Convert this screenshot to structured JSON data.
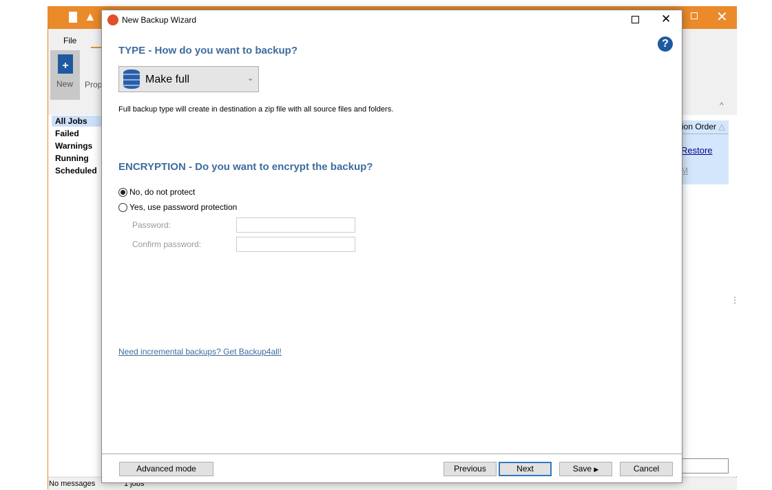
{
  "app": {
    "menu_file": "File",
    "ribbon_new": "New",
    "ribbon_properties": "Prop",
    "sidebar": [
      "All Jobs",
      "Failed",
      "Warnings",
      "Running",
      "Scheduled"
    ],
    "column_header": "ion Order",
    "link_restore": "Restore",
    "link_m": "M",
    "status_messages": "No messages",
    "status_jobs": "1 jobs"
  },
  "dialog": {
    "title": "New Backup Wizard",
    "type_heading": "TYPE - How do you want to backup?",
    "type_selected": "Make full",
    "type_description": "Full backup type will create in destination a zip file with all source files and folders.",
    "encryption_heading": "ENCRYPTION - Do you want to encrypt the backup?",
    "radio_no": "No, do not protect",
    "radio_yes": "Yes, use password protection",
    "selected_encryption": "No, do not protect",
    "password_label": "Password:",
    "confirm_label": "Confirm password:",
    "password_value": "",
    "confirm_value": "",
    "upsell_link": "Need incremental backups? Get Backup4all!",
    "buttons": {
      "advanced": "Advanced mode",
      "previous": "Previous",
      "next": "Next",
      "save": "Save",
      "cancel": "Cancel"
    }
  },
  "colors": {
    "accent": "#ea8a2a",
    "heading": "#3d6c9e",
    "help": "#1f5aa0"
  }
}
